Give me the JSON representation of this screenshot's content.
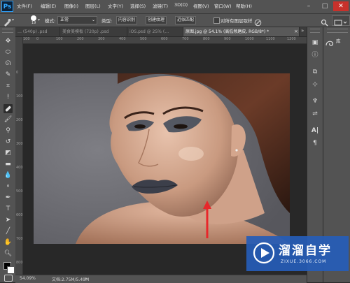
{
  "app": {
    "logo": "Ps"
  },
  "menu": [
    "文件(F)",
    "编辑(E)",
    "图像(I)",
    "图层(L)",
    "文字(Y)",
    "选择(S)",
    "滤镜(T)",
    "3D(D)",
    "视图(V)",
    "窗口(W)",
    "帮助(H)"
  ],
  "window_controls": {
    "minimize": "–",
    "maximize": "□",
    "close": "✕"
  },
  "options_bar": {
    "brush_size": "19",
    "mode_label": "模式:",
    "mode_value": "正常",
    "type_label": "类型:",
    "type_buttons": [
      "内容识别",
      "创建纹理",
      "近似匹配"
    ],
    "sample_all_label": "对所有图层取样",
    "sample_all_checked": false
  },
  "tabs": [
    {
      "label": "… (540p) .psd",
      "active": false
    },
    {
      "label": "美食美模板 (720p) .psd",
      "active": false
    },
    {
      "label": "iOS.psd @ 25% (…",
      "active": false
    },
    {
      "label": "原图.jpg @ 54.1% (高低频磨皮, RGB/8*) *",
      "active": true
    }
  ],
  "tab_close": "×",
  "ruler_top": [
    "100",
    "0",
    "100",
    "200",
    "300",
    "400",
    "500",
    "600",
    "700",
    "800",
    "900",
    "1000",
    "1100",
    "1200"
  ],
  "ruler_left": [
    "0",
    "100",
    "200",
    "300",
    "400",
    "500",
    "600",
    "700",
    "800"
  ],
  "status": {
    "zoom": "54.09%",
    "doc": "文档:2.75M/5.49M"
  },
  "right_panel": {
    "library_label": "库"
  },
  "watermark": {
    "title": "溜溜自学",
    "url": "ZIXUE.3066.COM"
  },
  "colors": {
    "ui_panel": "#535353",
    "workspace": "#282828",
    "accent_arrow": "#e8262a",
    "watermark_blue": "#265db7"
  }
}
